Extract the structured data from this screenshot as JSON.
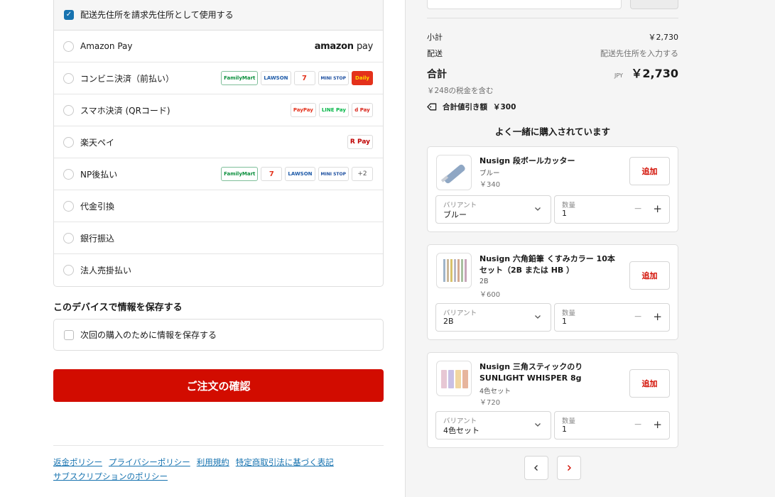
{
  "billing": {
    "label": "配送先住所を請求先住所として使用する",
    "checked": true
  },
  "payment_methods": [
    {
      "label": "Amazon Pay",
      "logos": [
        "amazon-pay-logo"
      ]
    },
    {
      "label": "コンビニ決済（前払い）",
      "logos": [
        "FamilyMart",
        "LAWSON",
        "7",
        "MINI STOP",
        "Daily"
      ]
    },
    {
      "label": "スマホ決済 (QRコード)",
      "logos": [
        "PayPay",
        "LINE Pay",
        "d Pay"
      ]
    },
    {
      "label": "楽天ペイ",
      "logos": [
        "R Pay"
      ]
    },
    {
      "label": "NP後払い",
      "logos": [
        "FamilyMart",
        "7",
        "LAWSON",
        "MINI STOP",
        "+2"
      ]
    },
    {
      "label": "代金引換",
      "logos": []
    },
    {
      "label": "銀行振込",
      "logos": []
    },
    {
      "label": "法人売掛払い",
      "logos": []
    }
  ],
  "amazon_logo": {
    "word": "amazon",
    "pay": "pay"
  },
  "save_section": {
    "title": "このデバイスで情報を保存する",
    "checkbox_label": "次回の購入のために情報を保存する"
  },
  "confirm_button": "ご注文の確認",
  "footer_links": [
    "返金ポリシー",
    "プライバシーポリシー",
    "利用規約",
    "特定商取引法に基づく表記",
    "サブスクリプションのポリシー"
  ],
  "summary": {
    "subtotal_label": "小計",
    "subtotal_value": "￥2,730",
    "shipping_label": "配送",
    "shipping_value": "配送先住所を入力する",
    "total_label": "合計",
    "currency": "JPY",
    "total_value": "￥2,730",
    "tax_note": "￥248の税金を含む",
    "discount_label": "合計値引き額",
    "discount_value": "￥300"
  },
  "recommend_title": "よく一緒に購入されています",
  "products": [
    {
      "name": "Nusign 段ボールカッター",
      "variant": "ブルー",
      "price": "￥340",
      "add_label": "追加",
      "variant_field_label": "バリアント",
      "variant_value": "ブルー",
      "qty_label": "数量",
      "qty_value": "1"
    },
    {
      "name": "Nusign 六角鉛筆 くすみカラー 10本セット（2B または HB ）",
      "variant": "2B",
      "price": "￥600",
      "add_label": "追加",
      "variant_field_label": "バリアント",
      "variant_value": "2B",
      "qty_label": "数量",
      "qty_value": "1"
    },
    {
      "name": "Nusign 三角スティックのり SUNLIGHT WHISPER 8g",
      "variant": "4色セット",
      "price": "￥720",
      "add_label": "追加",
      "variant_field_label": "バリアント",
      "variant_value": "4色セット",
      "qty_label": "数量",
      "qty_value": "1"
    }
  ],
  "colors": {
    "accent_red": "#d20c00",
    "link_blue": "#1773b0",
    "checkbox_blue": "#1773b0"
  }
}
